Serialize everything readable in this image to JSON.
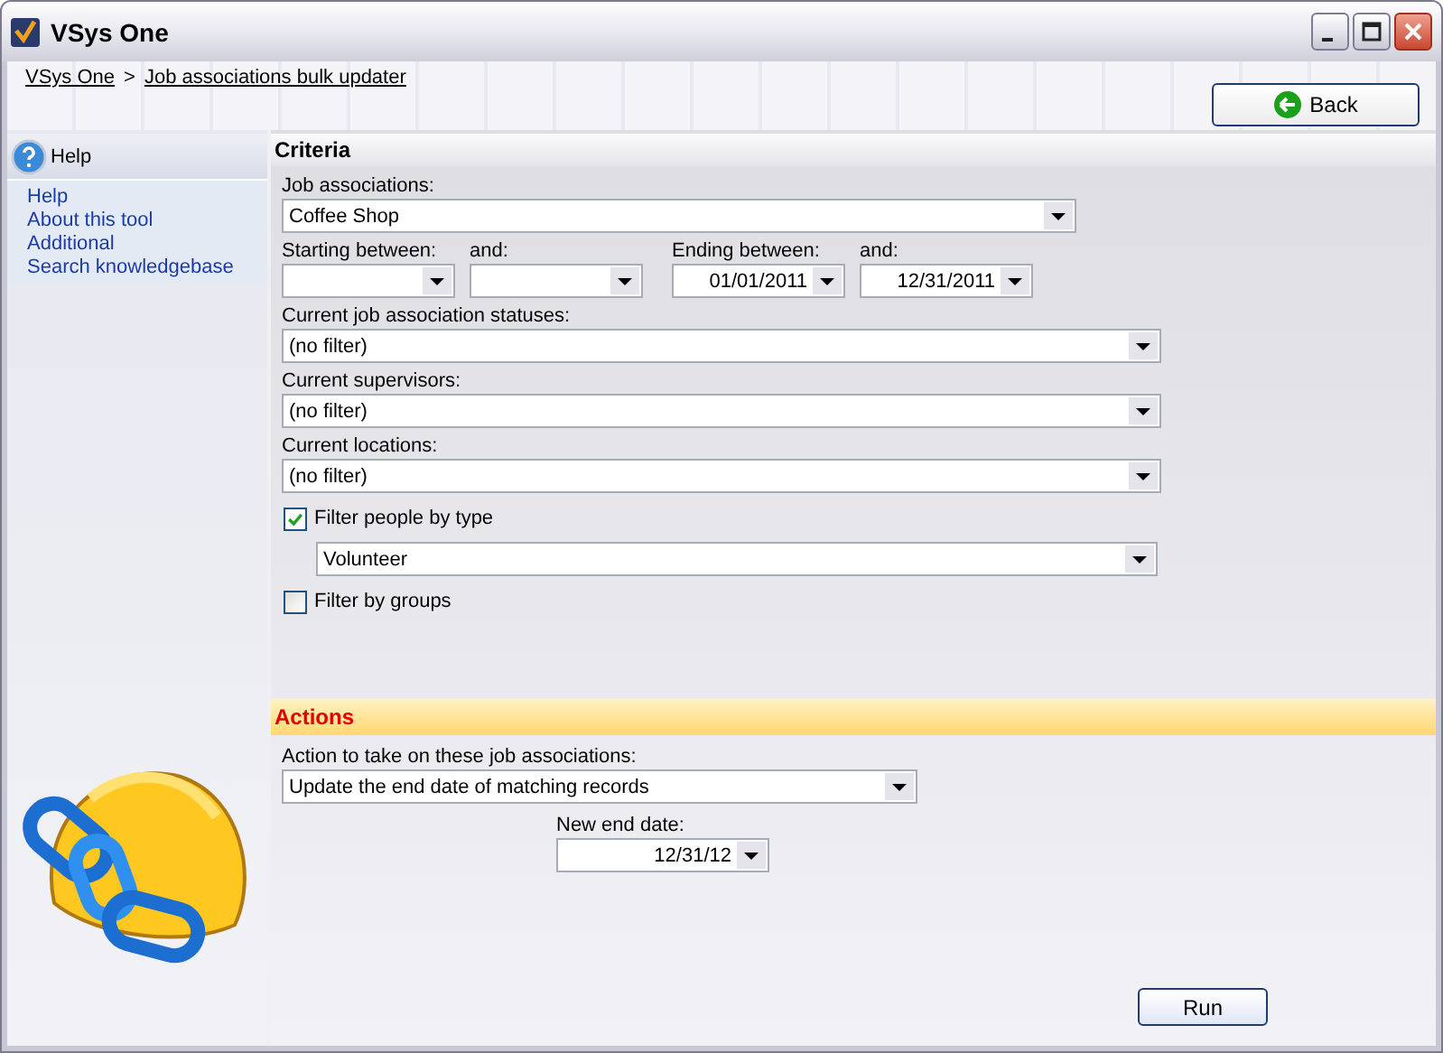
{
  "window": {
    "title": "VSys One"
  },
  "breadcrumb": {
    "items": [
      "VSys One",
      "Job associations bulk updater"
    ],
    "separator": ">"
  },
  "back_button": "Back",
  "help": {
    "title": "Help",
    "links": [
      "Help",
      "About this tool",
      "Additional",
      "Search knowledgebase"
    ]
  },
  "criteria": {
    "title": "Criteria",
    "job_associations": {
      "label": "Job associations:",
      "value": "Coffee Shop"
    },
    "starting": {
      "label": "Starting between:",
      "and_label": "and:"
    },
    "ending": {
      "label": "Ending between:",
      "from": "01/01/2011",
      "and_label": "and:",
      "to": "12/31/2011"
    },
    "filters": [
      {
        "label": "Current job association statuses:",
        "value": "(no filter)"
      },
      {
        "label": "Current supervisors:",
        "value": "(no filter)"
      },
      {
        "label": "Current locations:",
        "value": "(no filter)"
      }
    ],
    "people_type": {
      "label": "Filter people by type",
      "checked": true,
      "value": "Volunteer"
    },
    "groups": {
      "label": "Filter by groups",
      "checked": false
    }
  },
  "actions": {
    "title": "Actions",
    "label": "Action to take on these job associations:",
    "value": "Update the end date of matching records",
    "new_end_date": {
      "label": "New end date:",
      "value": "12/31/12"
    }
  },
  "run_button": "Run"
}
